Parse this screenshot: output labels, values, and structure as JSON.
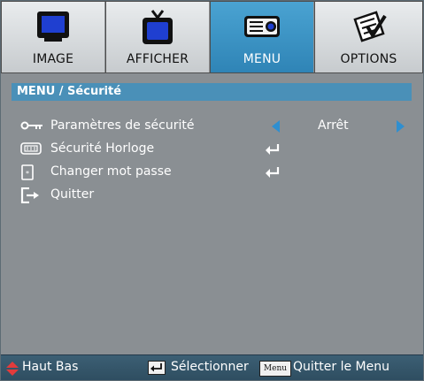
{
  "tabs": [
    {
      "label": "IMAGE",
      "active": false,
      "icon": "monitor-icon"
    },
    {
      "label": "AFFICHER",
      "active": false,
      "icon": "tv-icon"
    },
    {
      "label": "MENU",
      "active": true,
      "icon": "projector-icon"
    },
    {
      "label": "OPTIONS",
      "active": false,
      "icon": "checklist-icon"
    }
  ],
  "breadcrumb": "MENU / Sécurité",
  "items": {
    "security_settings": {
      "label": "Paramètres de sécurité",
      "value": "Arrêt",
      "icon": "key-icon"
    },
    "security_timer": {
      "label": "Sécurité Horloge",
      "icon": "clock-display-icon"
    },
    "change_password": {
      "label": "Changer mot passe",
      "icon": "password-card-icon"
    },
    "quit": {
      "label": "Quitter",
      "icon": "exit-door-icon"
    }
  },
  "footer": {
    "nav_label": "Haut Bas",
    "select_label": "Sélectionner",
    "menu_key": "Menu",
    "quit_label": "Quitter le Menu"
  },
  "colors": {
    "active_tab": "#3b93c4",
    "breadcrumb": "#4a90b8",
    "panel_bg": "#8a8f93",
    "arrow_blue": "#2f8fd0",
    "footer_bg": "#345669"
  }
}
